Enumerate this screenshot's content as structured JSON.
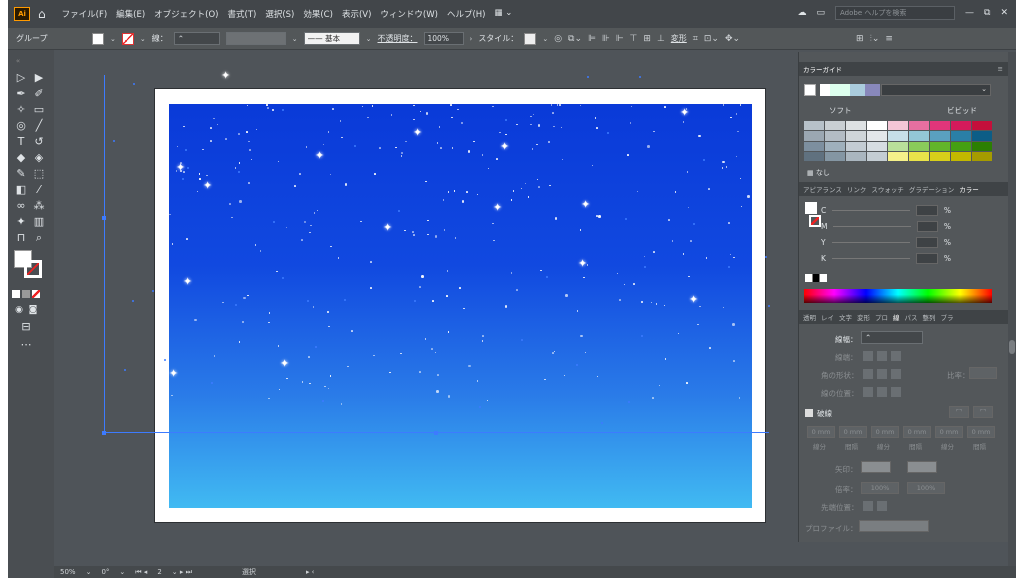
{
  "app": {
    "logo": "Ai",
    "window_buttons": [
      "—",
      "⧉",
      "✕"
    ]
  },
  "menu": [
    "ファイル(F)",
    "編集(E)",
    "オブジェクト(O)",
    "書式(T)",
    "選択(S)",
    "効果(C)",
    "表示(V)",
    "ウィンドウ(W)",
    "ヘルプ(H)"
  ],
  "search": {
    "placeholder": "Adobe ヘルプを検索"
  },
  "control": {
    "selection_label": "グループ",
    "stroke_label": "線：",
    "brush_label": "基本",
    "opacity_label": "不透明度：",
    "opacity_value": "100%",
    "style_label": "スタイル：",
    "transform_label": "変形"
  },
  "color_guide": {
    "tab": "カラーガイド",
    "soft": "ソフト",
    "vivid": "ビビッド",
    "none_label": "なし",
    "colors": [
      "#b7c1c9",
      "#c9cfd3",
      "#dde1e3",
      "#ffffff",
      "#f3c6d6",
      "#e66fa0",
      "#e0357a",
      "#d41a5b",
      "#c40f3b",
      "#9ba7b2",
      "#b3bcc4",
      "#cfd5d9",
      "#e3e7ea",
      "#c6dfe8",
      "#93c7d6",
      "#5aa0bf",
      "#2a7fa6",
      "#0c5d86",
      "#7d8f9f",
      "#9fb0bc",
      "#c3ccd3",
      "#d6dde2",
      "#b9e09a",
      "#8acb5a",
      "#62b52a",
      "#45a012",
      "#2c7f02",
      "#60717f",
      "#8496a3",
      "#aab6bf",
      "#c4cdd3",
      "#f5f18a",
      "#e9e34a",
      "#d7cf1a",
      "#c2b800",
      "#a59b00"
    ]
  },
  "tabs_mid": [
    "アピアランス",
    "リンク",
    "スウォッチ",
    "グラデーション",
    "カラー"
  ],
  "color_panel": {
    "channels": [
      "C",
      "M",
      "Y",
      "K"
    ],
    "unit": "%"
  },
  "tabs_stroke": [
    "透明",
    "レイ",
    "文字",
    "変形",
    "プロ",
    "線",
    "パス",
    "整列",
    "ブラ"
  ],
  "stroke_panel": {
    "weight_label": "線幅：",
    "cap_label": "線端：",
    "corner_label": "角の形状：",
    "limit_label": "比率：",
    "align_label": "線の位置：",
    "dashed_label": "破線",
    "dash_cells": [
      "0 mm",
      "0 mm",
      "0 mm",
      "0 mm",
      "0 mm",
      "0 mm"
    ],
    "dash_sub": [
      "線分",
      "間隔",
      "線分",
      "間隔",
      "線分",
      "間隔"
    ],
    "arrow_label": "矢印：",
    "scale_label": "倍率：",
    "scale_values": [
      "100%",
      "100%"
    ],
    "arrow_align_label": "先端位置：",
    "profile_label": "プロファイル："
  },
  "status": {
    "zoom": "50%",
    "rotate": "0°",
    "artboard": "2",
    "tool": "選択"
  }
}
